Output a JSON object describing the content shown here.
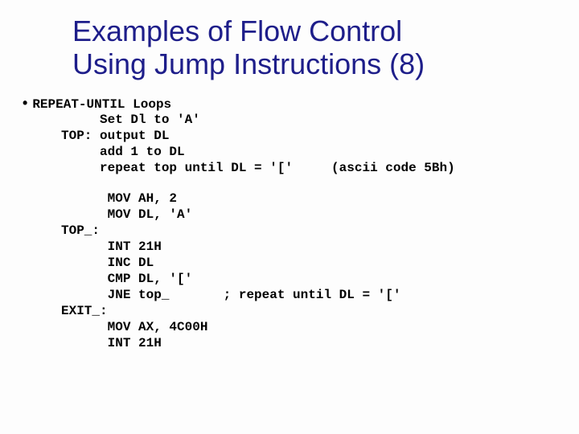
{
  "title_line1": "Examples of Flow Control",
  "title_line2": "Using Jump Instructions (8)",
  "bullet_heading": "REPEAT-UNTIL Loops",
  "pseudo": {
    "l1": "     Set Dl to 'A'",
    "l2": "TOP: output DL",
    "l3": "     add 1 to DL",
    "l4": "     repeat top until DL = '['     (ascii code 5Bh)"
  },
  "asm": {
    "l1": "      MOV AH, 2",
    "l2": "      MOV DL, 'A'",
    "l3": "TOP_:",
    "l4": "      INT 21H",
    "l5": "      INC DL",
    "l6": "      CMP DL, '['",
    "l7": "      JNE top_       ; repeat until DL = '['",
    "l8": "EXIT_:",
    "l9": "      MOV AX, 4C00H",
    "l10": "      INT 21H"
  }
}
